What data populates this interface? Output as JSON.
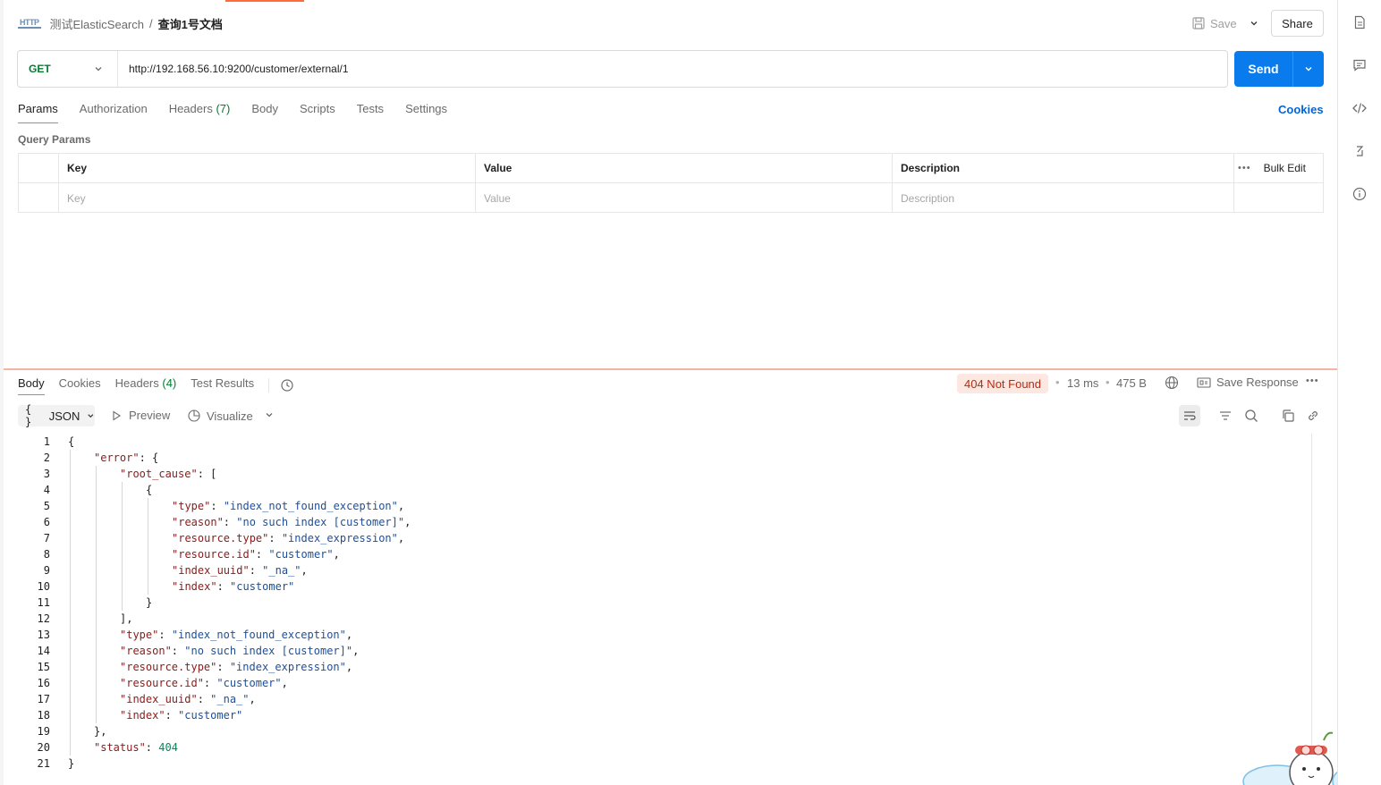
{
  "header": {
    "badge": "HTTP",
    "collection": "测试ElasticSearch",
    "separator": "/",
    "request_name": "查询1号文档",
    "save_label": "Save",
    "share_label": "Share"
  },
  "request": {
    "method": "GET",
    "url": "http://192.168.56.10:9200/customer/external/1",
    "send_label": "Send"
  },
  "request_tabs": [
    {
      "label": "Params"
    },
    {
      "label": "Authorization"
    },
    {
      "label": "Headers",
      "count": "(7)"
    },
    {
      "label": "Body"
    },
    {
      "label": "Scripts"
    },
    {
      "label": "Tests"
    },
    {
      "label": "Settings"
    }
  ],
  "cookies_label": "Cookies",
  "query_params": {
    "title": "Query Params",
    "columns": [
      "Key",
      "Value",
      "Description"
    ],
    "bulk_edit": "Bulk Edit",
    "placeholders": [
      "Key",
      "Value",
      "Description"
    ]
  },
  "response_tabs": [
    {
      "label": "Body"
    },
    {
      "label": "Cookies"
    },
    {
      "label": "Headers",
      "count": "(4)"
    },
    {
      "label": "Test Results"
    }
  ],
  "response_meta": {
    "status": "404 Not Found",
    "time": "13 ms",
    "size": "475 B",
    "save_response": "Save Response"
  },
  "viewer": {
    "format": "JSON",
    "format_icon": "{ }",
    "preview": "Preview",
    "visualize": "Visualize"
  },
  "response_body": [
    {
      "n": "1",
      "indent": 0,
      "parts": [
        [
          "p",
          "{"
        ]
      ]
    },
    {
      "n": "2",
      "indent": 1,
      "parts": [
        [
          "k",
          "\"error\""
        ],
        [
          "p",
          ": {"
        ]
      ]
    },
    {
      "n": "3",
      "indent": 2,
      "parts": [
        [
          "k",
          "\"root_cause\""
        ],
        [
          "p",
          ": ["
        ]
      ]
    },
    {
      "n": "4",
      "indent": 3,
      "parts": [
        [
          "p",
          "{"
        ]
      ]
    },
    {
      "n": "5",
      "indent": 4,
      "parts": [
        [
          "k",
          "\"type\""
        ],
        [
          "p",
          ": "
        ],
        [
          "s",
          "\"index_not_found_exception\""
        ],
        [
          "p",
          ","
        ]
      ]
    },
    {
      "n": "6",
      "indent": 4,
      "parts": [
        [
          "k",
          "\"reason\""
        ],
        [
          "p",
          ": "
        ],
        [
          "s",
          "\"no such index [customer]\""
        ],
        [
          "p",
          ","
        ]
      ]
    },
    {
      "n": "7",
      "indent": 4,
      "parts": [
        [
          "k",
          "\"resource.type\""
        ],
        [
          "p",
          ": "
        ],
        [
          "s",
          "\"index_expression\""
        ],
        [
          "p",
          ","
        ]
      ]
    },
    {
      "n": "8",
      "indent": 4,
      "parts": [
        [
          "k",
          "\"resource.id\""
        ],
        [
          "p",
          ": "
        ],
        [
          "s",
          "\"customer\""
        ],
        [
          "p",
          ","
        ]
      ]
    },
    {
      "n": "9",
      "indent": 4,
      "parts": [
        [
          "k",
          "\"index_uuid\""
        ],
        [
          "p",
          ": "
        ],
        [
          "s",
          "\"_na_\""
        ],
        [
          "p",
          ","
        ]
      ]
    },
    {
      "n": "10",
      "indent": 4,
      "parts": [
        [
          "k",
          "\"index\""
        ],
        [
          "p",
          ": "
        ],
        [
          "s",
          "\"customer\""
        ]
      ]
    },
    {
      "n": "11",
      "indent": 3,
      "parts": [
        [
          "p",
          "}"
        ]
      ]
    },
    {
      "n": "12",
      "indent": 2,
      "parts": [
        [
          "p",
          "],"
        ]
      ]
    },
    {
      "n": "13",
      "indent": 2,
      "parts": [
        [
          "k",
          "\"type\""
        ],
        [
          "p",
          ": "
        ],
        [
          "s",
          "\"index_not_found_exception\""
        ],
        [
          "p",
          ","
        ]
      ]
    },
    {
      "n": "14",
      "indent": 2,
      "parts": [
        [
          "k",
          "\"reason\""
        ],
        [
          "p",
          ": "
        ],
        [
          "s",
          "\"no such index [customer]\""
        ],
        [
          "p",
          ","
        ]
      ]
    },
    {
      "n": "15",
      "indent": 2,
      "parts": [
        [
          "k",
          "\"resource.type\""
        ],
        [
          "p",
          ": "
        ],
        [
          "s",
          "\"index_expression\""
        ],
        [
          "p",
          ","
        ]
      ]
    },
    {
      "n": "16",
      "indent": 2,
      "parts": [
        [
          "k",
          "\"resource.id\""
        ],
        [
          "p",
          ": "
        ],
        [
          "s",
          "\"customer\""
        ],
        [
          "p",
          ","
        ]
      ]
    },
    {
      "n": "17",
      "indent": 2,
      "parts": [
        [
          "k",
          "\"index_uuid\""
        ],
        [
          "p",
          ": "
        ],
        [
          "s",
          "\"_na_\""
        ],
        [
          "p",
          ","
        ]
      ]
    },
    {
      "n": "18",
      "indent": 2,
      "parts": [
        [
          "k",
          "\"index\""
        ],
        [
          "p",
          ": "
        ],
        [
          "s",
          "\"customer\""
        ]
      ]
    },
    {
      "n": "19",
      "indent": 1,
      "parts": [
        [
          "p",
          "},"
        ]
      ]
    },
    {
      "n": "20",
      "indent": 1,
      "parts": [
        [
          "k",
          "\"status\""
        ],
        [
          "p",
          ": "
        ],
        [
          "n",
          "404"
        ]
      ]
    },
    {
      "n": "21",
      "indent": 0,
      "parts": [
        [
          "p",
          "}"
        ]
      ]
    }
  ],
  "icons": {
    "right_rail": [
      "document-icon",
      "comment-icon",
      "code-icon",
      "related-collections-icon",
      "info-icon"
    ],
    "toolbar": [
      "wrap-lines-icon",
      "filter-icon",
      "search-icon",
      "copy-icon",
      "link-icon"
    ]
  },
  "colors": {
    "accent": "#ff6c37",
    "send": "#097bed",
    "method_get": "#007f31",
    "status_error_bg": "#fde7e1",
    "status_error_text": "#b42c12",
    "json_key": "#8b1a1a",
    "json_string": "#1c4f9c",
    "json_number": "#098658"
  }
}
